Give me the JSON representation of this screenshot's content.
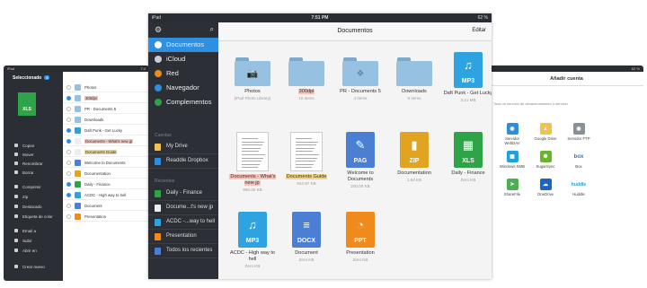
{
  "left_device": {
    "status_left": "iPad",
    "status_right": "7:4",
    "selected_label": "Seleccionado",
    "selected_count": "5",
    "big_icon_label": "XLS",
    "actions": [
      "Copiar",
      "Mover",
      "Renombrar",
      "Borrar",
      "Comprimir",
      "Zip",
      "Destacado",
      "Etiqueta de color",
      "Email a",
      "Subir",
      "Abrir en",
      "Crear nuevo"
    ],
    "files": [
      {
        "name": "Photos",
        "checked": false,
        "style": "",
        "color": "#96c1e0"
      },
      {
        "name": "300dpi",
        "checked": true,
        "style": "hl",
        "color": "#96c1e0"
      },
      {
        "name": "PR - Documents 5",
        "checked": false,
        "style": "",
        "color": "#96c1e0"
      },
      {
        "name": "Downloads",
        "checked": false,
        "style": "",
        "color": "#96c1e0"
      },
      {
        "name": "Daft Punk - Get Lucky",
        "checked": true,
        "style": "",
        "color": "#2ea3e0"
      },
      {
        "name": "Documents - What's new jp",
        "checked": true,
        "style": "hl",
        "color": "#eee"
      },
      {
        "name": "Documents Guide",
        "checked": false,
        "style": "hy",
        "color": "#eee"
      },
      {
        "name": "Welcome to Documents",
        "checked": false,
        "style": "",
        "color": "#4a7fd4"
      },
      {
        "name": "Documentation",
        "checked": false,
        "style": "",
        "color": "#e0a420"
      },
      {
        "name": "Daily - Finance",
        "checked": true,
        "style": "",
        "color": "#2ea347"
      },
      {
        "name": "ACDC - High way to hell",
        "checked": true,
        "style": "",
        "color": "#2ea3e0"
      },
      {
        "name": "Document",
        "checked": false,
        "style": "",
        "color": "#4a7fd4"
      },
      {
        "name": "Presentation",
        "checked": false,
        "style": "",
        "color": "#f08a1c"
      }
    ]
  },
  "right_device": {
    "status_right": "62 %",
    "title": "Añadir cuenta",
    "subtitle": "Toca un servicio de almacenamiento o servicio",
    "services": [
      {
        "name": "Servidor WebDAV",
        "color": "#2d8de0",
        "glyph": "◉"
      },
      {
        "name": "Google Drive",
        "color": "#f2c14e",
        "glyph": "▲"
      },
      {
        "name": "Servidor FTP",
        "color": "#8a8f99",
        "glyph": "◉"
      },
      {
        "name": "Windows SMB",
        "color": "#1ea1e0",
        "glyph": "▦"
      },
      {
        "name": "SugarSync",
        "color": "#6ab42d",
        "glyph": "✽"
      },
      {
        "name": "Box",
        "color": "#ffffff",
        "glyph": "box"
      },
      {
        "name": "ShareFile",
        "color": "#4caf50",
        "glyph": "➤"
      },
      {
        "name": "OneDrive",
        "color": "#1a63c7",
        "glyph": "☁"
      },
      {
        "name": "Huddle",
        "color": "#ffffff",
        "glyph": "huddle"
      }
    ]
  },
  "main": {
    "status_left": "iPad",
    "status_center": "7:51 PM",
    "status_right": "62 %",
    "title": "Documentos",
    "edit_label": "Editar",
    "sidebar_items": [
      {
        "label": "Documentos",
        "color": "#ffffff",
        "active": true
      },
      {
        "label": "iCloud",
        "color": "#c9ccd2",
        "active": false
      },
      {
        "label": "Red",
        "color": "#f08a1c",
        "active": false
      },
      {
        "label": "Navegador",
        "color": "#2d8de0",
        "active": false
      },
      {
        "label": "Complementos",
        "color": "#2ea347",
        "active": false
      }
    ],
    "cuentas_header": "Cuentas",
    "accounts": [
      {
        "label": "My Drive",
        "color": "#f2c14e"
      },
      {
        "label": "Readdle Dropbox",
        "color": "#2d8de0"
      }
    ],
    "recientes_header": "Recientes",
    "recents": [
      {
        "label": "Daily - Finance",
        "color": "#2ea347"
      },
      {
        "label": "Docume...t's new jp",
        "color": "#eeeeee"
      },
      {
        "label": "ACDC -...way to hell",
        "color": "#2ea3e0"
      },
      {
        "label": "Presentation",
        "color": "#f08a1c"
      },
      {
        "label": "Todos los recientes",
        "color": "#4a7fd4"
      }
    ],
    "tiles": [
      {
        "kind": "folder",
        "name": "Photos",
        "meta": "(iPad Photo Library)",
        "sym": "📷",
        "style": ""
      },
      {
        "kind": "folder",
        "name": "300dpi",
        "meta": "10 items",
        "sym": "",
        "style": "hl"
      },
      {
        "kind": "folder",
        "name": "PR - Documents 5",
        "meta": "4 items",
        "sym": "❖",
        "style": ""
      },
      {
        "kind": "folder",
        "name": "Downloads",
        "meta": "6 items",
        "sym": "",
        "style": ""
      },
      {
        "kind": "doc",
        "name": "Daft Punk - Get Lucky",
        "meta": "3.21 MB",
        "label": "MP3",
        "color": "#2ea3e0",
        "sym": "♫",
        "style": ""
      },
      {
        "kind": "paper",
        "name": "Documents - What's new jp",
        "meta": "990.00 KB",
        "style": "hl"
      },
      {
        "kind": "paper",
        "name": "Documents Guide",
        "meta": "944.97 KB",
        "style": "hy"
      },
      {
        "kind": "doc",
        "name": "Welcome to Documents",
        "meta": "200.00 KB",
        "label": "PAG",
        "color": "#4a7fd4",
        "sym": "✎",
        "style": ""
      },
      {
        "kind": "doc",
        "name": "Documentation",
        "meta": "1.64 KB",
        "label": "ZIP",
        "color": "#e0a420",
        "sym": "▮",
        "style": ""
      },
      {
        "kind": "doc",
        "name": "Daily - Finance",
        "meta": "Zero KB",
        "label": "XLS",
        "color": "#2ea347",
        "sym": "▦",
        "style": ""
      },
      {
        "kind": "doc",
        "name": "ACDC - High way to hell",
        "meta": "Zero KB",
        "label": "MP3",
        "color": "#2ea3e0",
        "sym": "♫",
        "style": ""
      },
      {
        "kind": "doc",
        "name": "Document",
        "meta": "Zero KB",
        "label": "DOCX",
        "color": "#4a7fd4",
        "sym": "≡",
        "style": ""
      },
      {
        "kind": "doc",
        "name": "Presentation",
        "meta": "Zero KB",
        "label": "PPT",
        "color": "#f08a1c",
        "sym": "◔",
        "style": ""
      }
    ]
  }
}
